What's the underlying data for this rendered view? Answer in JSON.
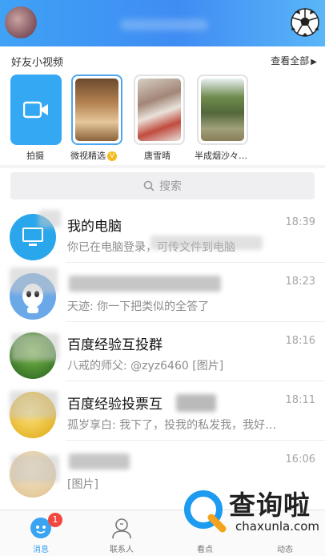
{
  "header": {
    "profile_icon": "avatar",
    "right_icon": "soccer-ball-icon"
  },
  "friends_videos": {
    "title": "好友小视频",
    "view_all": "查看全部",
    "items": [
      {
        "label": "拍摄",
        "icon": "camera-icon"
      },
      {
        "label": "微视精选",
        "badge": "V"
      },
      {
        "label": "唐雪晴"
      },
      {
        "label": "半成烟沙々…"
      }
    ]
  },
  "search": {
    "placeholder": "搜索"
  },
  "chats": [
    {
      "name": "我的电脑",
      "message": "你已在电脑登录，可传文件到电脑",
      "time": "18:39"
    },
    {
      "name": "",
      "message": "天迹: 你一下把类似的全答了",
      "time": "18:23"
    },
    {
      "name": "百度经验互投群",
      "message": "八戒的师父: @zyz6460 [图片]",
      "time": "18:16"
    },
    {
      "name": "百度经验投票互",
      "message": "孤岁享白: 我下了，投我的私发我，我好…",
      "time": "18:11"
    },
    {
      "name": "",
      "message": "[图片]",
      "time": "16:06"
    }
  ],
  "bottom_nav": {
    "tabs": [
      {
        "label": "消息",
        "icon": "message-icon",
        "badge": "1",
        "active": true
      },
      {
        "label": "联系人",
        "icon": "contacts-icon"
      },
      {
        "label": "看点",
        "icon": "star-icon"
      },
      {
        "label": "动态",
        "icon": "compass-icon"
      }
    ]
  },
  "watermark": {
    "text": "查询啦",
    "sub": "chaxunla.com"
  },
  "colors": {
    "header": "#3f8cf3",
    "accent": "#39a2f0",
    "badge": "#f2473f"
  }
}
